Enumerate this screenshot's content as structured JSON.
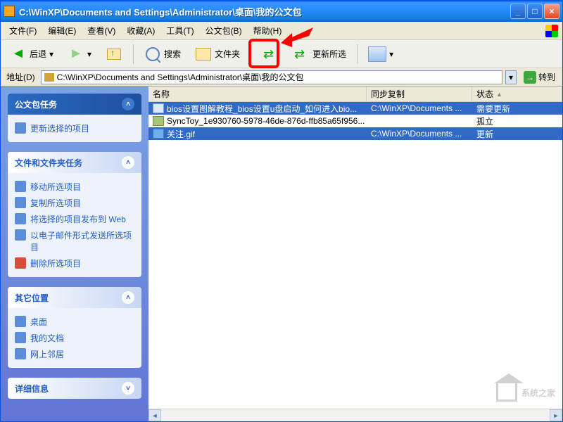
{
  "title": "C:\\WinXP\\Documents and Settings\\Administrator\\桌面\\我的公文包",
  "menu": [
    "文件(F)",
    "编辑(E)",
    "查看(V)",
    "收藏(A)",
    "工具(T)",
    "公文包(B)",
    "帮助(H)"
  ],
  "toolbar": {
    "back": "后退",
    "search": "搜索",
    "folders": "文件夹",
    "update_all": "更新所选"
  },
  "addressbar": {
    "label": "地址(D)",
    "path": "C:\\WinXP\\Documents and Settings\\Administrator\\桌面\\我的公文包",
    "go": "转到"
  },
  "side": {
    "briefcase": {
      "title": "公文包任务",
      "items": [
        "更新选择的项目"
      ]
    },
    "filetasks": {
      "title": "文件和文件夹任务",
      "items": [
        "移动所选项目",
        "复制所选项目",
        "将选择的项目发布到 Web",
        "以电子邮件形式发送所选项目",
        "删除所选项目"
      ]
    },
    "other": {
      "title": "其它位置",
      "items": [
        "桌面",
        "我的文档",
        "网上邻居"
      ]
    },
    "details": {
      "title": "详细信息"
    }
  },
  "columns": [
    "名称",
    "同步复制",
    "状态"
  ],
  "rows": [
    {
      "name": "bios设置图解教程_bios设置u盘启动_如何进入bio...",
      "sync": "C:\\WinXP\\Documents ...",
      "status": "需要更新",
      "icon": "doc",
      "sel": true
    },
    {
      "name": "SyncToy_1e930760-5978-46de-876d-ffb85a65f956...",
      "sync": "",
      "status": "孤立",
      "icon": "dat",
      "sel": false
    },
    {
      "name": "关注.gif",
      "sync": "C:\\WinXP\\Documents ...",
      "status": "更新",
      "icon": "img",
      "sel": true
    }
  ],
  "watermark": "系统之家"
}
